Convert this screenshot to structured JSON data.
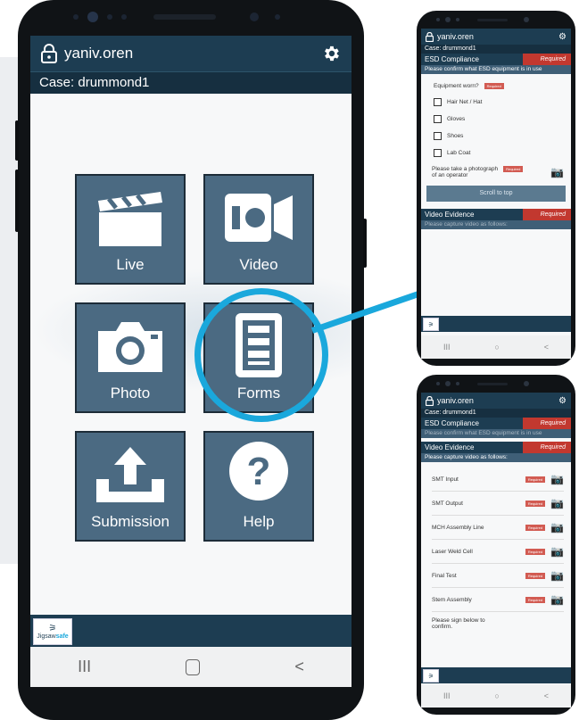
{
  "app": {
    "username": "yaniv.oren",
    "case_label": "Case: drummond1",
    "logo_text_jigsaw": "Jigsaw",
    "logo_text_safe": "safe"
  },
  "main": {
    "tiles": [
      {
        "label": "Live",
        "icon": "clapperboard-icon"
      },
      {
        "label": "Video",
        "icon": "video-camera-icon"
      },
      {
        "label": "Photo",
        "icon": "camera-icon"
      },
      {
        "label": "Forms",
        "icon": "form-document-icon"
      },
      {
        "label": "Submission",
        "icon": "upload-tray-icon"
      },
      {
        "label": "Help",
        "icon": "help-question-icon"
      }
    ],
    "nav": {
      "recents": "III",
      "home": "○",
      "back": "<"
    }
  },
  "screen1": {
    "username": "yaniv.oren",
    "case_label": "Case: drummond1",
    "esd_title": "ESD Compliance",
    "required_label": "Required",
    "esd_prompt": "Please confirm what ESD equipment is in use",
    "equipment_question": "Equipment worn?",
    "mini_required": "Required",
    "checkboxes": [
      "Hair Net / Hat",
      "Gloves",
      "Shoes",
      "Lab Coat"
    ],
    "photo_prompt_line1": "Please take a photograph",
    "photo_prompt_line2": "of an operator",
    "scroll_button": "Scroll to top",
    "video_title": "Video Evidence",
    "video_prompt": "Please capture video as follows:"
  },
  "screen2": {
    "username": "yaniv.oren",
    "case_label": "Case: drummond1",
    "esd_title": "ESD Compliance",
    "required_label": "Required",
    "esd_prompt": "Please confirm what ESD equipment is in use",
    "video_title": "Video Evidence",
    "video_prompt": "Please capture video as follows:",
    "mini_required": "Required",
    "video_items": [
      "SMT Input",
      "SMT Output",
      "MCH Assembly Line",
      "Laser Weld Cell",
      "Final Test",
      "Stem Assembly"
    ],
    "sign_prompt_line1": "Please sign below to",
    "sign_prompt_line2": "confirm."
  },
  "colors": {
    "header": "#1d3d52",
    "tile": "#4b6a82",
    "required": "#c2382f",
    "highlight": "#1aa8dc"
  }
}
